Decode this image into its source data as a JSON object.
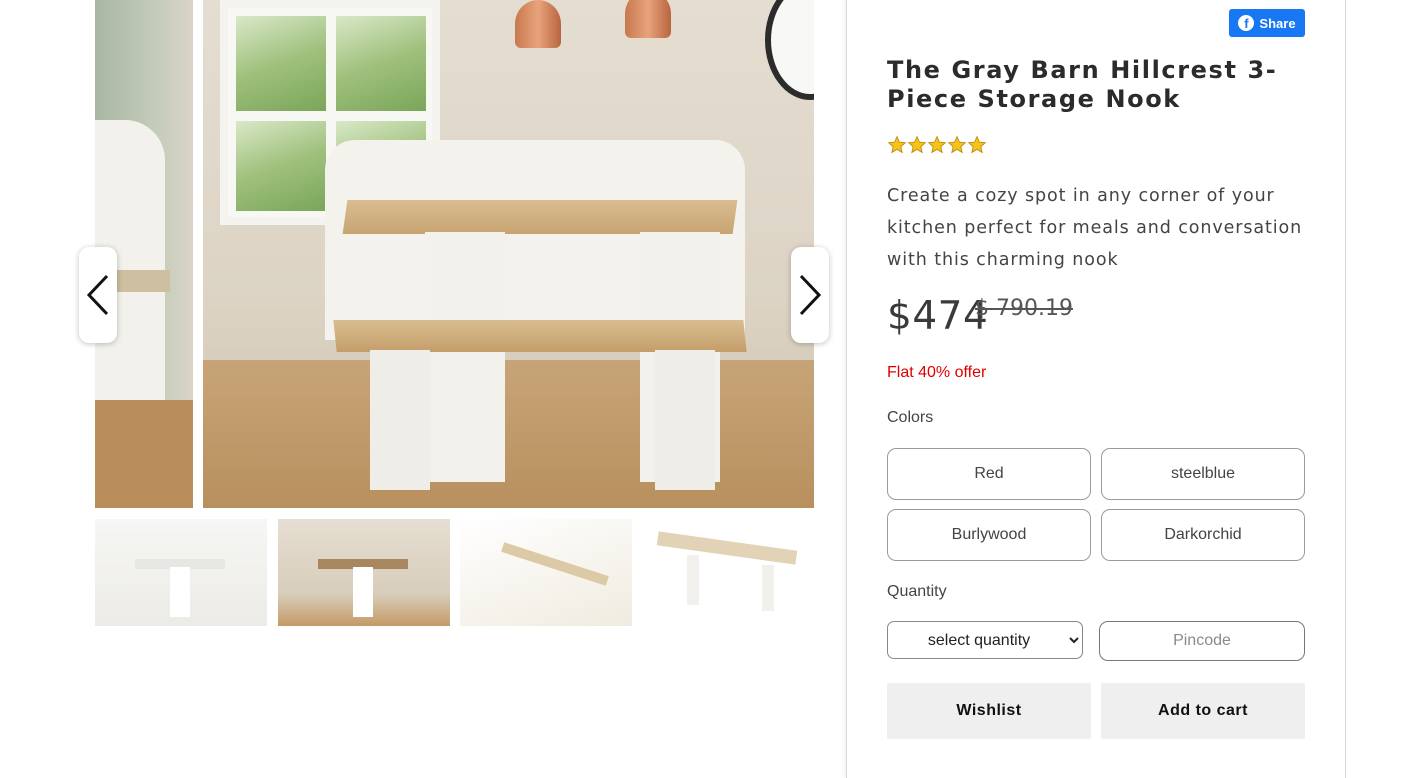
{
  "product": {
    "title": "The Gray Barn Hillcrest 3-Piece Storage Nook",
    "rating": 5,
    "rating_max": 5,
    "description": "Create a cozy spot in any corner of your kitchen perfect for meals and conversation with this charming nook",
    "price": "$474",
    "original_price": "$ 790.19",
    "offer": "Flat 40% offer"
  },
  "share": {
    "label": "Share",
    "icon": "facebook-icon"
  },
  "colors": {
    "label": "Colors",
    "options": [
      "Red",
      "steelblue",
      "Burlywood",
      "Darkorchid"
    ]
  },
  "quantity": {
    "label": "Quantity",
    "selected": "select quantity",
    "pincode_placeholder": "Pincode"
  },
  "actions": {
    "wishlist": "Wishlist",
    "add_to_cart": "Add to cart"
  },
  "gallery": {
    "prev_icon": "chevron-left-icon",
    "next_icon": "chevron-right-icon",
    "thumbnail_count": 4
  },
  "theme": {
    "facebook_blue": "#1877f2",
    "offer_red": "#e00000",
    "star_gold": "#f7c21a"
  }
}
